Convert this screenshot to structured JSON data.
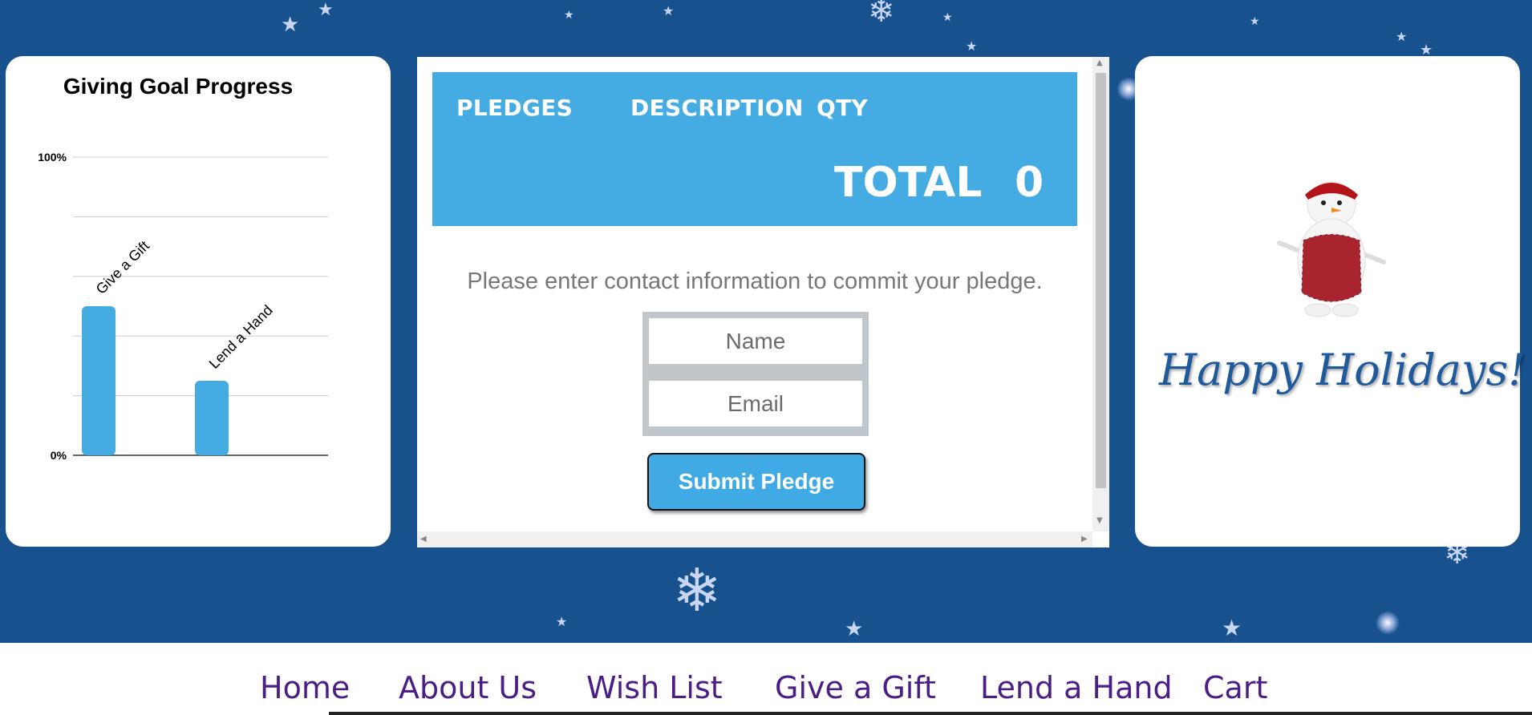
{
  "chart": {
    "title": "Giving Goal Progress",
    "color": "#45abe3"
  },
  "chart_data": {
    "type": "bar",
    "title": "Giving Goal Progress",
    "categories": [
      "Give a Gift",
      "Lend a Hand"
    ],
    "values": [
      50,
      25
    ],
    "ylim": [
      0,
      100
    ],
    "yticks": [
      "0%",
      "100%"
    ],
    "grid": true
  },
  "pledges": {
    "columns": [
      "PLEDGES",
      "DESCRIPTION",
      "QTY"
    ],
    "total_label": "TOTAL",
    "total_value": "0",
    "header_color": "#45abe3",
    "contact_message": "Please enter contact information to commit your pledge.",
    "name_placeholder": "Name",
    "email_placeholder": "Email",
    "submit_label": "Submit Pledge"
  },
  "greeting": "Happy Holidays!",
  "nav": {
    "items": [
      "Home",
      "About Us",
      "Wish List",
      "Give a Gift",
      "Lend a Hand",
      "Cart"
    ],
    "color": "#4b1d86"
  },
  "icons": [
    "star-icon",
    "snowflake-icon",
    "snowman-icon"
  ]
}
